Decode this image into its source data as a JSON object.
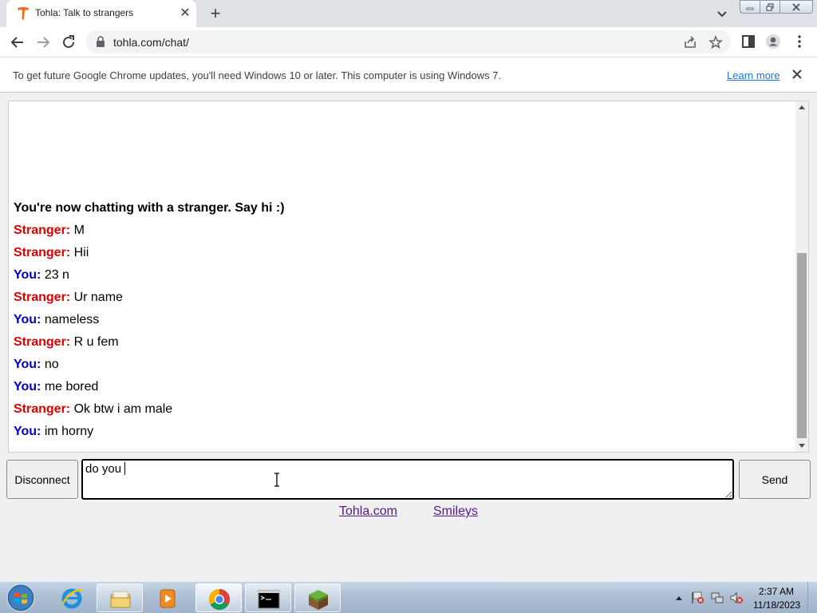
{
  "browser": {
    "tab_title": "Tohla: Talk to strangers",
    "url": "tohla.com/chat/"
  },
  "infobar": {
    "message": "To get future Google Chrome updates, you'll need Windows 10 or later. This computer is using Windows 7.",
    "learn_more": "Learn more"
  },
  "chat": {
    "status": "You're now chatting with a stranger. Say hi :)",
    "messages": [
      {
        "sender": "Stranger:",
        "role": "stranger",
        "text": "M"
      },
      {
        "sender": "Stranger:",
        "role": "stranger",
        "text": "Hii"
      },
      {
        "sender": "You:",
        "role": "you",
        "text": "23 n"
      },
      {
        "sender": "Stranger:",
        "role": "stranger",
        "text": "Ur name"
      },
      {
        "sender": "You:",
        "role": "you",
        "text": "nameless"
      },
      {
        "sender": "Stranger:",
        "role": "stranger",
        "text": "R u fem"
      },
      {
        "sender": "You:",
        "role": "you",
        "text": "no"
      },
      {
        "sender": "You:",
        "role": "you",
        "text": "me bored"
      },
      {
        "sender": "Stranger:",
        "role": "stranger",
        "text": "Ok btw i am male"
      },
      {
        "sender": "You:",
        "role": "you",
        "text": "im horny"
      }
    ],
    "input_value": "do you ",
    "disconnect_label": "Disconnect",
    "send_label": "Send"
  },
  "footer": {
    "site_link": "Tohla.com",
    "smileys_link": "Smileys"
  },
  "taskbar": {
    "time": "2:37 AM",
    "date": "11/18/2023"
  },
  "colors": {
    "stranger": "#e00000",
    "you": "#0000c8",
    "accent_link": "#1a73e8",
    "visited_link": "#551a8b"
  },
  "icons": {
    "favicon": "tohla-t-icon",
    "back": "arrow-left-icon",
    "forward": "arrow-right-icon",
    "reload": "reload-icon",
    "lock": "lock-icon",
    "share": "share-icon",
    "bookmark": "star-icon",
    "sidepanel": "side-panel-icon",
    "profile": "profile-icon",
    "menu": "kebab-menu-icon"
  }
}
